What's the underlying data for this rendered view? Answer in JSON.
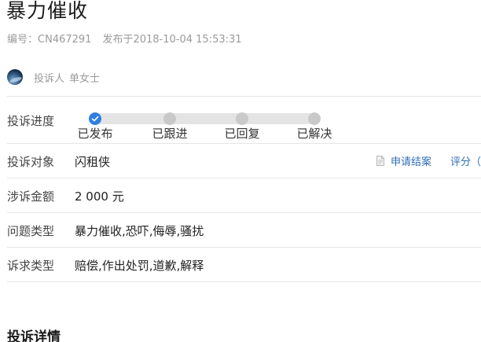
{
  "complaint": {
    "title": "暴力催收",
    "number_label": "编号：",
    "number": "CN467291",
    "published_label": "发布于",
    "published_at": "2018-10-04 15:53:31"
  },
  "author": {
    "role_label": "投诉人",
    "name": "单女士"
  },
  "progress": {
    "label": "投诉进度",
    "steps": [
      {
        "label": "已发布",
        "done": true
      },
      {
        "label": "已跟进",
        "done": false
      },
      {
        "label": "已回复",
        "done": false
      },
      {
        "label": "已解决",
        "done": false
      }
    ]
  },
  "target": {
    "label": "投诉对象",
    "value": "闪租侠",
    "apply_close_label": "申请结案",
    "rate_label": "评分（"
  },
  "amount": {
    "label": "涉诉金额",
    "value": "2 000 元"
  },
  "issue_type": {
    "label": "问题类型",
    "value": "暴力催收,恐吓,侮辱,骚扰"
  },
  "demand_type": {
    "label": "诉求类型",
    "value": "赔偿,作出处罚,道歉,解释"
  },
  "details": {
    "title": "投诉详情"
  },
  "colors": {
    "accent": "#2f7fe0",
    "link": "#2f6db5",
    "pending_dot": "#c9c9c9",
    "muted_text": "#9a9a9a"
  },
  "icons": {
    "step_done": "check-icon",
    "apply_close": "document-icon"
  }
}
